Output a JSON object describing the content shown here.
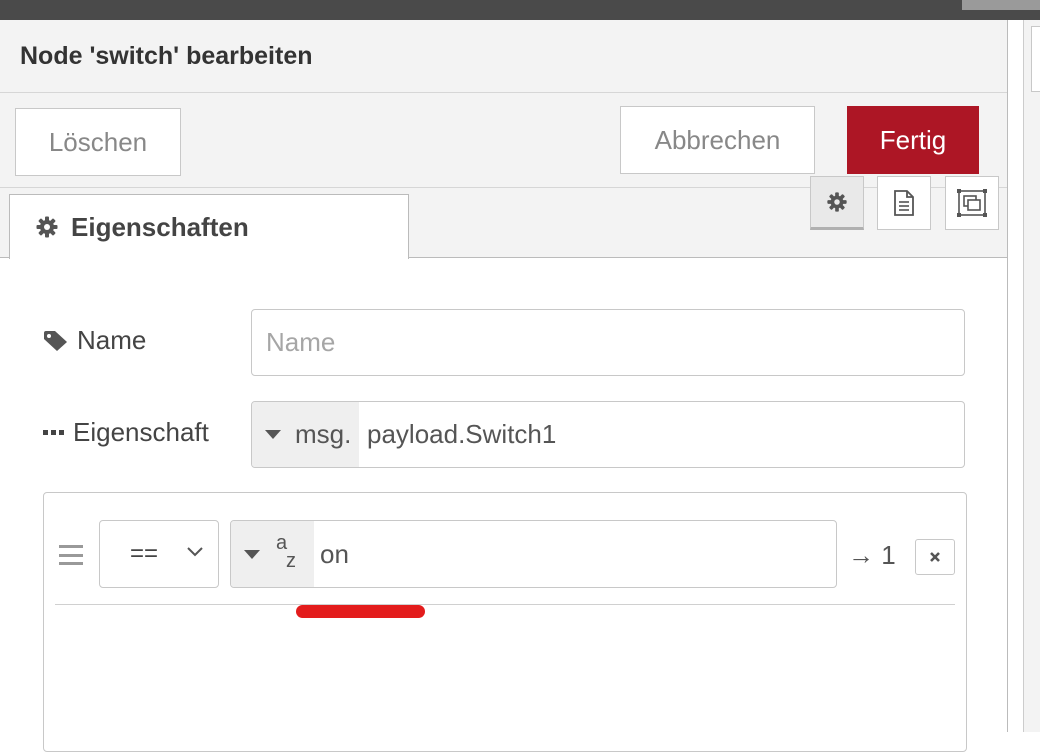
{
  "tray": {
    "title": "Node 'switch' bearbeiten",
    "delete_label": "Löschen",
    "cancel_label": "Abbrechen",
    "done_label": "Fertig",
    "done_color": "#ad1625"
  },
  "tabs": {
    "properties_label": "Eigenschaften",
    "side_buttons": [
      "node-properties-icon",
      "node-description-icon",
      "node-appearance-icon"
    ]
  },
  "form": {
    "name_label": "Name",
    "name_value": "",
    "name_placeholder": "Name",
    "property_label": "Eigenschaft",
    "property_type": "msg.",
    "property_value": "payload.Switch1"
  },
  "rule": {
    "operator": "==",
    "value_type": "az-string-icon",
    "value": "on",
    "output": "→ 1"
  },
  "annotation": {
    "underline_color": "#e31c1c"
  }
}
